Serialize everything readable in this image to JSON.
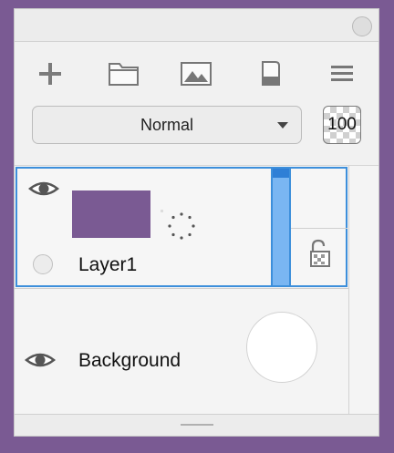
{
  "toolbar": {
    "tools": [
      {
        "name": "add-layer-icon"
      },
      {
        "name": "folder-icon"
      },
      {
        "name": "image-icon"
      },
      {
        "name": "eraser-icon"
      },
      {
        "name": "menu-icon"
      }
    ]
  },
  "blend": {
    "mode": "Normal",
    "opacity": "100"
  },
  "layers": [
    {
      "name": "Layer1",
      "visible": true,
      "selected": true,
      "thumbnail_color": "#7a5a93",
      "locked": false
    },
    {
      "name": "Background",
      "visible": true,
      "selected": false
    }
  ],
  "colors": {
    "accent": "#3d8fdb",
    "background": "#7a5a93"
  }
}
